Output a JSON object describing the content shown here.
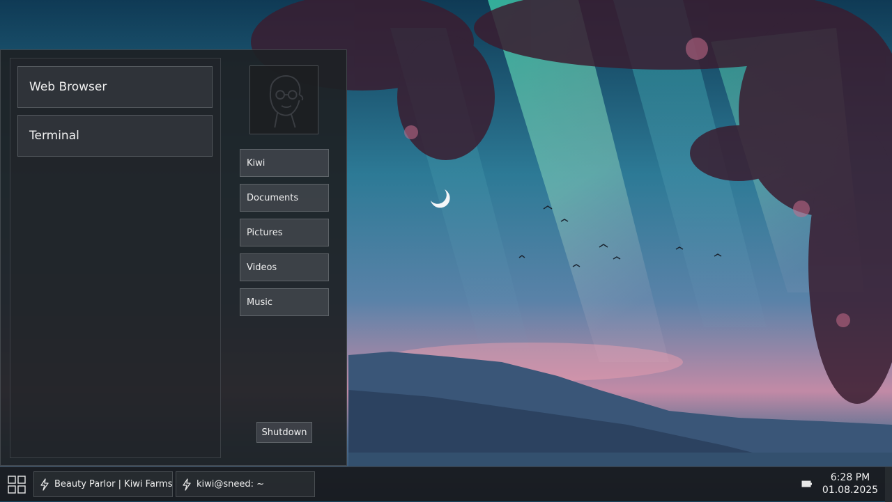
{
  "menu": {
    "apps": [
      {
        "label": "Web Browser"
      },
      {
        "label": "Terminal"
      }
    ],
    "places": [
      {
        "label": "Kiwi"
      },
      {
        "label": "Documents"
      },
      {
        "label": "Pictures"
      },
      {
        "label": "Videos"
      },
      {
        "label": "Music"
      }
    ],
    "shutdown_label": "Shutdown",
    "avatar_icon": "user-avatar-icon"
  },
  "taskbar": {
    "start_icon": "grid-icon",
    "tasks": [
      {
        "label": "Beauty Parlor | Kiwi Farms —",
        "icon": "bolt-icon"
      },
      {
        "label": "kiwi@sneed: ~",
        "icon": "bolt-icon"
      }
    ],
    "battery_icon": "battery-icon",
    "time": "6:28 PM",
    "date": "01.08.2025"
  },
  "desktop": {
    "loading_icon": "spinner-icon"
  }
}
